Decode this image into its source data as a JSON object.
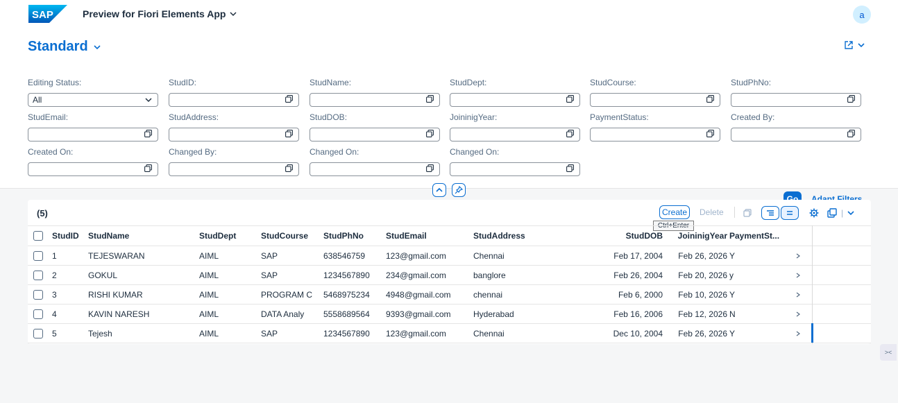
{
  "shell": {
    "logo_text": "SAP",
    "app_title": "Preview for Fiori Elements App",
    "avatar_initial": "a"
  },
  "header": {
    "variant_name": "Standard"
  },
  "filters": [
    {
      "label": "Editing Status:",
      "value": "All",
      "type": "select"
    },
    {
      "label": "StudID:",
      "value": "",
      "type": "input"
    },
    {
      "label": "StudName:",
      "value": "",
      "type": "input"
    },
    {
      "label": "StudDept:",
      "value": "",
      "type": "input"
    },
    {
      "label": "StudCourse:",
      "value": "",
      "type": "input"
    },
    {
      "label": "StudPhNo:",
      "value": "",
      "type": "input"
    },
    {
      "label": "StudEmail:",
      "value": "",
      "type": "input"
    },
    {
      "label": "StudAddress:",
      "value": "",
      "type": "input"
    },
    {
      "label": "StudDOB:",
      "value": "",
      "type": "input"
    },
    {
      "label": "JoininigYear:",
      "value": "",
      "type": "input"
    },
    {
      "label": "PaymentStatus:",
      "value": "",
      "type": "input"
    },
    {
      "label": "Created By:",
      "value": "",
      "type": "input"
    },
    {
      "label": "Created On:",
      "value": "",
      "type": "input"
    },
    {
      "label": "Changed By:",
      "value": "",
      "type": "input"
    },
    {
      "label": "Changed On:",
      "value": "",
      "type": "input"
    },
    {
      "label": "Changed On:",
      "value": "",
      "type": "input"
    }
  ],
  "filter_actions": {
    "go_label": "Go",
    "adapt_label": "Adapt Filters"
  },
  "table": {
    "count": "(5)",
    "create_label": "Create",
    "create_tooltip": "Ctrl+Enter",
    "delete_label": "Delete",
    "columns": [
      "StudID",
      "StudName",
      "StudDept",
      "StudCourse",
      "StudPhNo",
      "StudEmail",
      "StudAddress",
      "StudDOB",
      "JoininigYear",
      "PaymentSt..."
    ],
    "rows": [
      [
        "1",
        "TEJESWARAN",
        "AIML",
        "SAP",
        "638546759",
        "123@gmail.com",
        "Chennai",
        "Feb 17, 2004",
        "Feb 26, 2026",
        "Y"
      ],
      [
        "2",
        "GOKUL",
        "AIML",
        "SAP",
        "1234567890",
        "234@gmail.com",
        "banglore",
        "Feb 26, 2004",
        "Feb 20, 2026",
        "y"
      ],
      [
        "3",
        "RISHI KUMAR",
        "AIML",
        "PROGRAM C",
        "5468975234",
        "4948@gmail.com",
        "chennai",
        "Feb 6, 2000",
        "Feb 10, 2026",
        "Y"
      ],
      [
        "4",
        "KAVIN NARESH",
        "AIML",
        "DATA Analy",
        "5558689564",
        "9393@gmail.com",
        "Hyderabad",
        "Feb 16, 2006",
        "Feb 12, 2026",
        "N"
      ],
      [
        "5",
        "Tejesh",
        "AIML",
        "SAP",
        "1234567890",
        "123@gmail.com",
        "Chennai",
        "Dec 10, 2004",
        "Feb 26, 2026",
        "Y"
      ]
    ]
  },
  "colors": {
    "accent": "#0a6ed1",
    "text": "#1d2d3e",
    "label": "#556b82"
  }
}
